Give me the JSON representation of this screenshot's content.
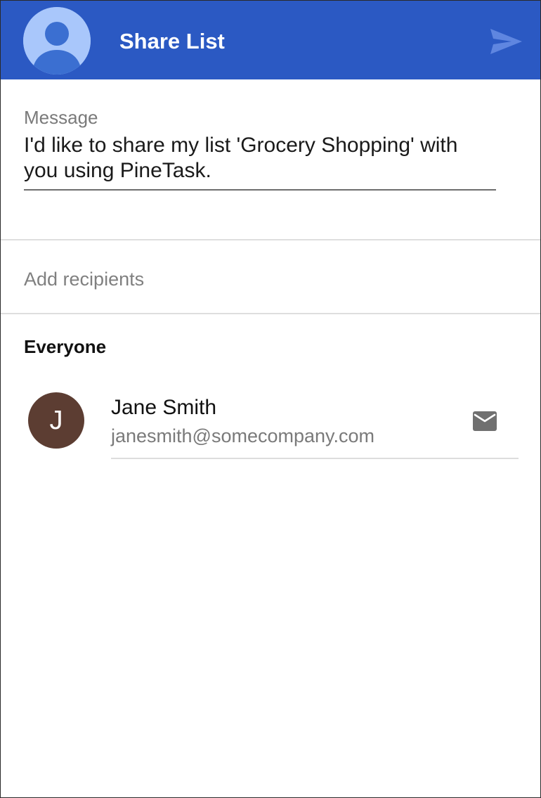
{
  "app_bar": {
    "title": "Share List",
    "avatar_icon": "account-circle-icon",
    "send_icon": "send-icon",
    "background_color": "#2b59c3",
    "send_icon_color": "#5f86e0"
  },
  "message": {
    "label": "Message",
    "value": "I'd like to share my list 'Grocery Shopping' with you using PineTask."
  },
  "recipients": {
    "placeholder": "Add recipients"
  },
  "contacts": {
    "section_title": "Everyone",
    "items": [
      {
        "initial": "J",
        "name": "Jane Smith",
        "email": "janesmith@somecompany.com",
        "avatar_color": "#5c3d32",
        "action_icon": "mail-icon"
      }
    ]
  }
}
